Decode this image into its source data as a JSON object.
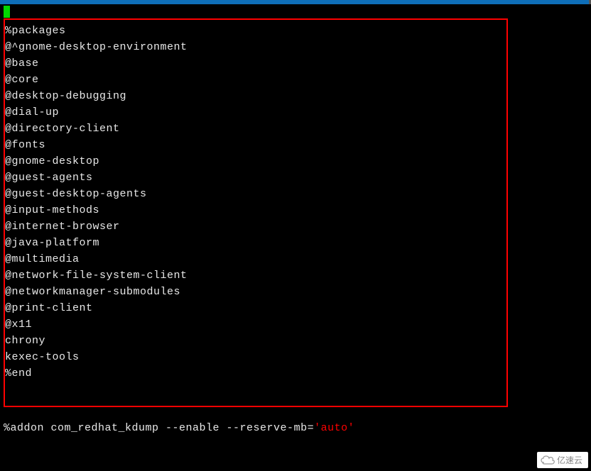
{
  "terminal": {
    "lines": {
      "packages_header": "%packages",
      "pkg1": "@^gnome-desktop-environment",
      "pkg2": "@base",
      "pkg3": "@core",
      "pkg4": "@desktop-debugging",
      "pkg5": "@dial-up",
      "pkg6": "@directory-client",
      "pkg7": "@fonts",
      "pkg8": "@gnome-desktop",
      "pkg9": "@guest-agents",
      "pkg10": "@guest-desktop-agents",
      "pkg11": "@input-methods",
      "pkg12": "@internet-browser",
      "pkg13": "@java-platform",
      "pkg14": "@multimedia",
      "pkg15": "@network-file-system-client",
      "pkg16": "@networkmanager-submodules",
      "pkg17": "@print-client",
      "pkg18": "@x11",
      "pkg19": "chrony",
      "pkg20": "kexec-tools",
      "blank": "",
      "end_marker": "%end"
    },
    "addon_line": {
      "cmd": "%addon com_redhat_kdump --enable --reserve-mb=",
      "quote1": "'",
      "value": "auto",
      "quote2": "'"
    }
  },
  "watermark": {
    "text": "亿速云"
  }
}
